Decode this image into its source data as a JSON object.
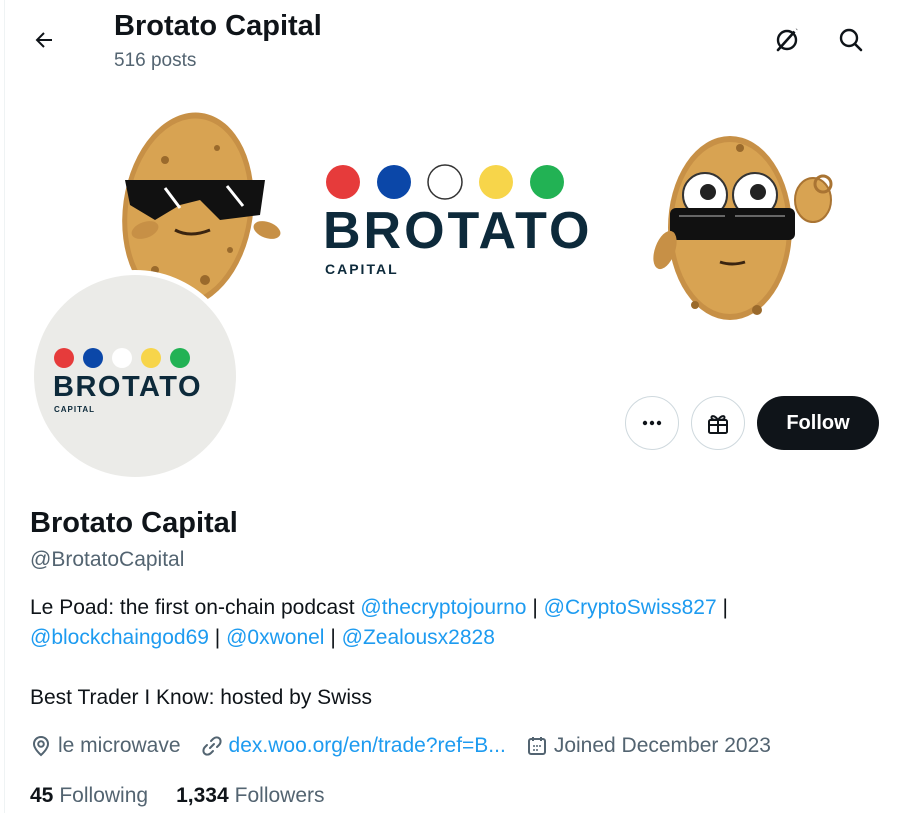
{
  "header": {
    "title": "Brotato Capital",
    "post_count": "516 posts",
    "back_icon": "arrow-left-icon",
    "grok_icon": "grok-icon",
    "search_icon": "search-icon"
  },
  "banner": {
    "logo_word": "BROTATO",
    "logo_sub": "CAPITAL",
    "dot_colors": [
      "#e63b3b",
      "#0b47a8",
      "#ffffff",
      "#f7d54a",
      "#22b254"
    ]
  },
  "avatar": {
    "logo_word": "BROTATO",
    "logo_sub": "CAPITAL"
  },
  "actions": {
    "more_icon": "more-icon",
    "gift_icon": "gift-icon",
    "follow_label": "Follow"
  },
  "profile": {
    "name": "Brotato Capital",
    "handle": "@BrotatoCapital",
    "bio_prefix": "Le Poad: the first on-chain podcast",
    "mentions": [
      "@thecryptojourno",
      "@CryptoSwiss827",
      "@blockchaingod69",
      "@0xwonel",
      "@Zealousx2828"
    ],
    "separator": "|",
    "bio_line2": "Best Trader I Know: hosted by Swiss",
    "location": "le microwave",
    "website": "dex.woo.org/en/trade?ref=B...",
    "joined": "Joined December 2023"
  },
  "stats": {
    "following_count": "45",
    "following_label": "Following",
    "followers_count": "1,334",
    "followers_label": "Followers"
  },
  "colors": {
    "accent": "#1d9bf0",
    "text": "#0f1419",
    "muted": "#536471",
    "border": "#cfd9de"
  }
}
